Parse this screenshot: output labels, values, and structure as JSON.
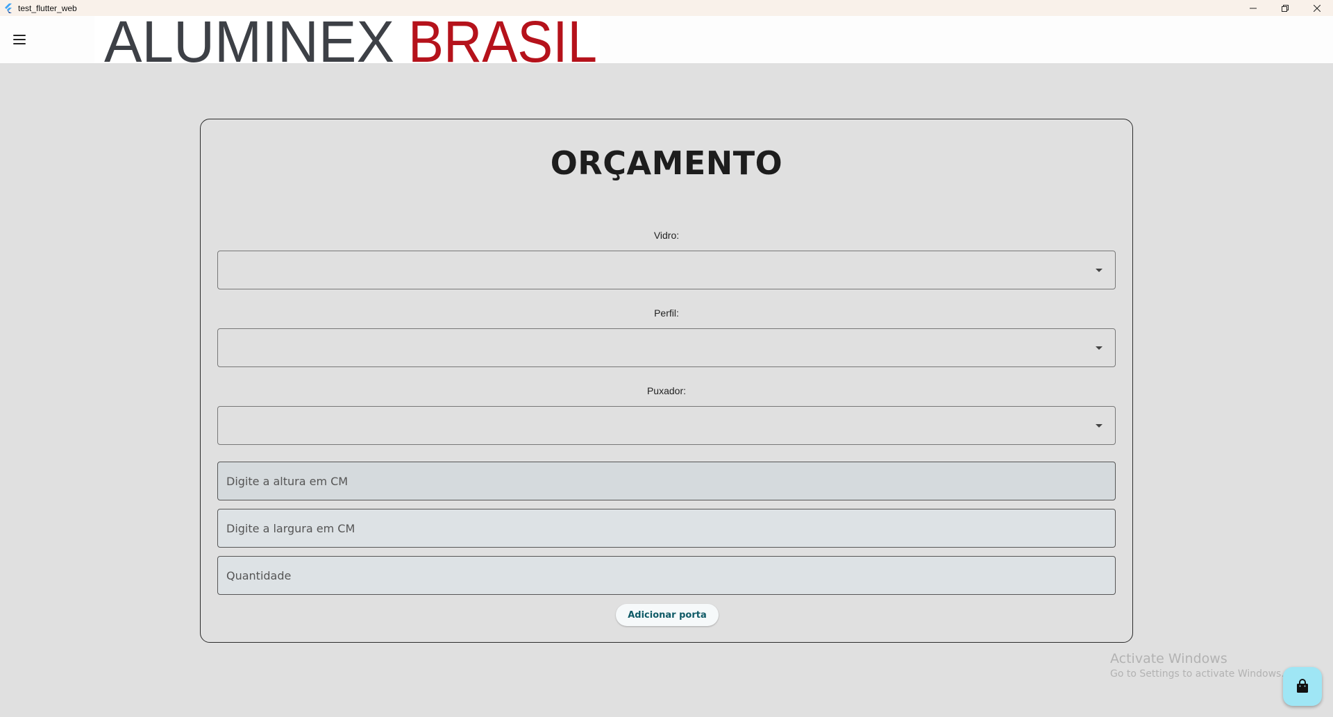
{
  "window": {
    "title": "test_flutter_web",
    "controls": [
      "minimize-icon",
      "restore-icon",
      "close-icon"
    ]
  },
  "appbar": {
    "menu_icon": "menu-icon",
    "logo": {
      "part1": "ALUMINEX",
      "part2": "BRASIL",
      "color1": "#3d4046",
      "color2": "#b5121b"
    }
  },
  "form": {
    "title": "ORÇAMENTO",
    "vidro": {
      "label": "Vidro:",
      "value": ""
    },
    "perfil": {
      "label": "Perfil:",
      "value": ""
    },
    "puxador": {
      "label": "Puxador:",
      "value": ""
    },
    "altura": {
      "placeholder": "Digite a altura em CM",
      "value": ""
    },
    "largura": {
      "placeholder": "Digite a largura em CM",
      "value": ""
    },
    "quantidade": {
      "placeholder": "Quantidade",
      "value": ""
    },
    "add_button": "Adicionar porta"
  },
  "watermark": {
    "line1": "Activate Windows",
    "line2": "Go to Settings to activate Windows."
  },
  "fab": {
    "icon": "shopping-bag-icon",
    "color": "#9fe6f5"
  }
}
